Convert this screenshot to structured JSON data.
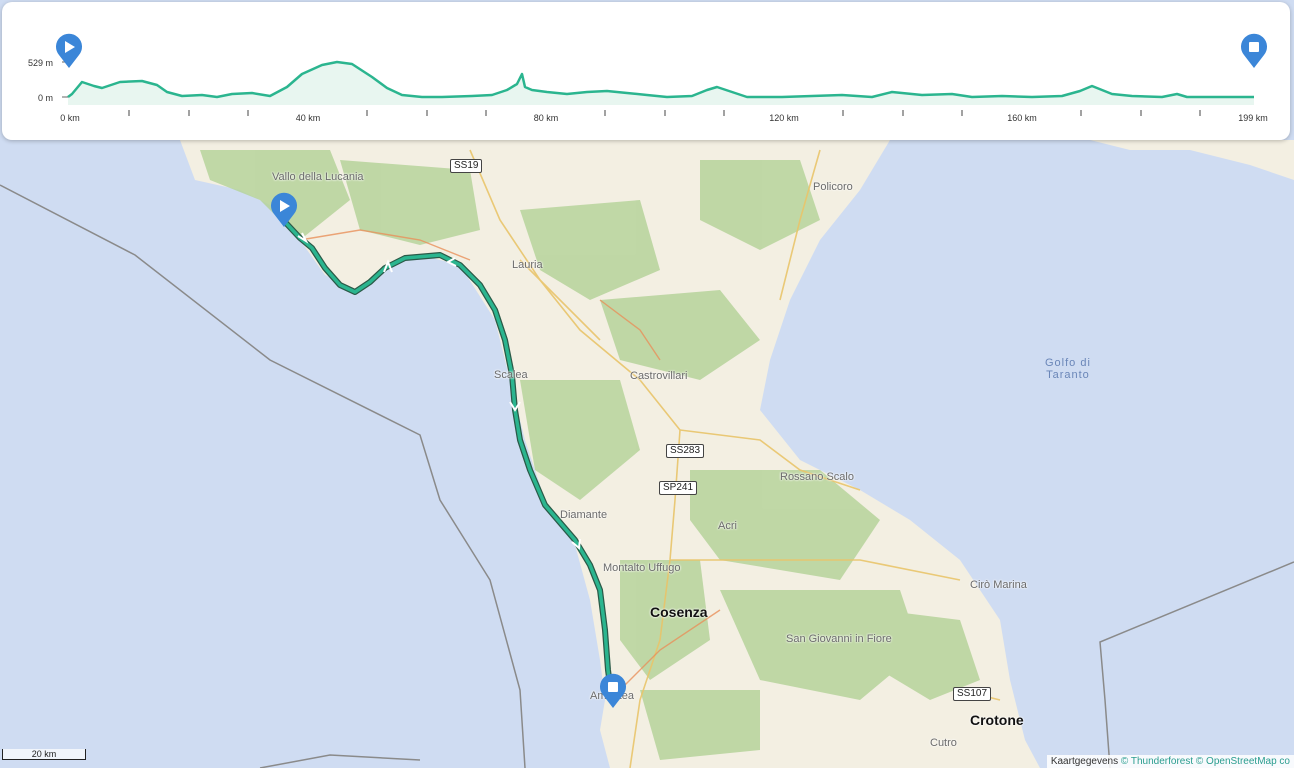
{
  "elevation": {
    "y_max_label": "529 m",
    "y_min_label": "0 m",
    "x_labels": [
      "0 km",
      "40 km",
      "80 km",
      "120 km",
      "160 km",
      "199 km"
    ]
  },
  "places": {
    "vallo": "Vallo della Lucania",
    "policoro": "Policoro",
    "lauria": "Lauria",
    "scalea": "Scalea",
    "castrovillari": "Castrovillari",
    "golfo_line1": "Golfo di",
    "golfo_line2": "Taranto",
    "rossano": "Rossano Scalo",
    "acri": "Acri",
    "cirò": "Cirò Marina",
    "diamante": "Diamante",
    "montalto": "Montalto Uffugo",
    "cosenza": "Cosenza",
    "sangiovanni": "San Giovanni in Fiore",
    "crotone": "Crotone",
    "cutro": "Cutro",
    "amantea": "Amantea"
  },
  "roads": {
    "ss19": "SS19",
    "ss283": "SS283",
    "sp241": "SP241",
    "ss107": "SS107"
  },
  "scale": "20 km",
  "attribution": {
    "prefix": "Kaartgegevens",
    "thunderforest": "© Thunderforest",
    "osm": "© OpenStreetMap co"
  },
  "colors": {
    "route": "#2bb58f",
    "pin": "#3b86d8",
    "sea": "#cfdcf2",
    "land": "#f3efe2",
    "forest": "#b6d39b"
  },
  "icons": {
    "start": "play-icon",
    "end": "stop-icon"
  }
}
